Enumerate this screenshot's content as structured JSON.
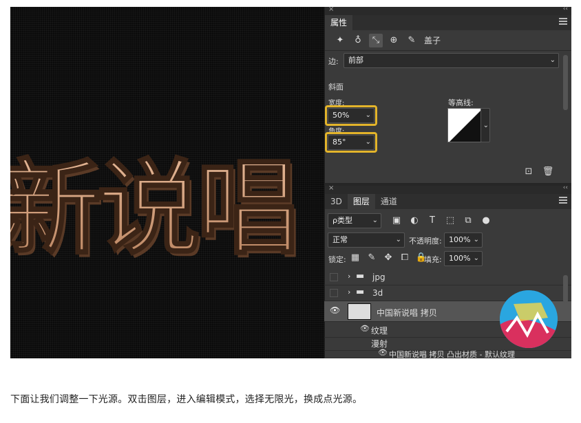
{
  "canvas": {
    "artwork_text": "新说唱"
  },
  "properties": {
    "panel_title": "属性",
    "icon_tab_label": "盖子",
    "edge_label": "边:",
    "edge_value": "前部",
    "bevel_label": "斜面",
    "width_label": "宽度:",
    "width_value": "50%",
    "angle_label": "角度:",
    "angle_value": "85°",
    "contour_label": "等高线:"
  },
  "layers": {
    "tabs": [
      "3D",
      "图层",
      "通道"
    ],
    "filter_kind": "ρ类型",
    "blend_mode": "正常",
    "opacity_label": "不透明度:",
    "opacity_value": "100%",
    "lock_label": "锁定:",
    "fill_label": "填充:",
    "fill_value": "100%",
    "items": [
      {
        "name": "jpg"
      },
      {
        "name": "3d"
      },
      {
        "name": "中国新说唱 拷贝"
      },
      {
        "name": "纹理"
      },
      {
        "name": "漫射"
      },
      {
        "name": "中国新说唱 拷贝 凸出材质 - 默认纹理"
      }
    ]
  },
  "caption": "下面让我们调整一下光源。双击图层，进入编辑模式，选择无限光，换成点光源。",
  "colors": {
    "highlight": "#e3b42a",
    "panel": "#3a3a3a",
    "canvas": "#0b0b0b",
    "text_fill": "#d9a98a"
  }
}
